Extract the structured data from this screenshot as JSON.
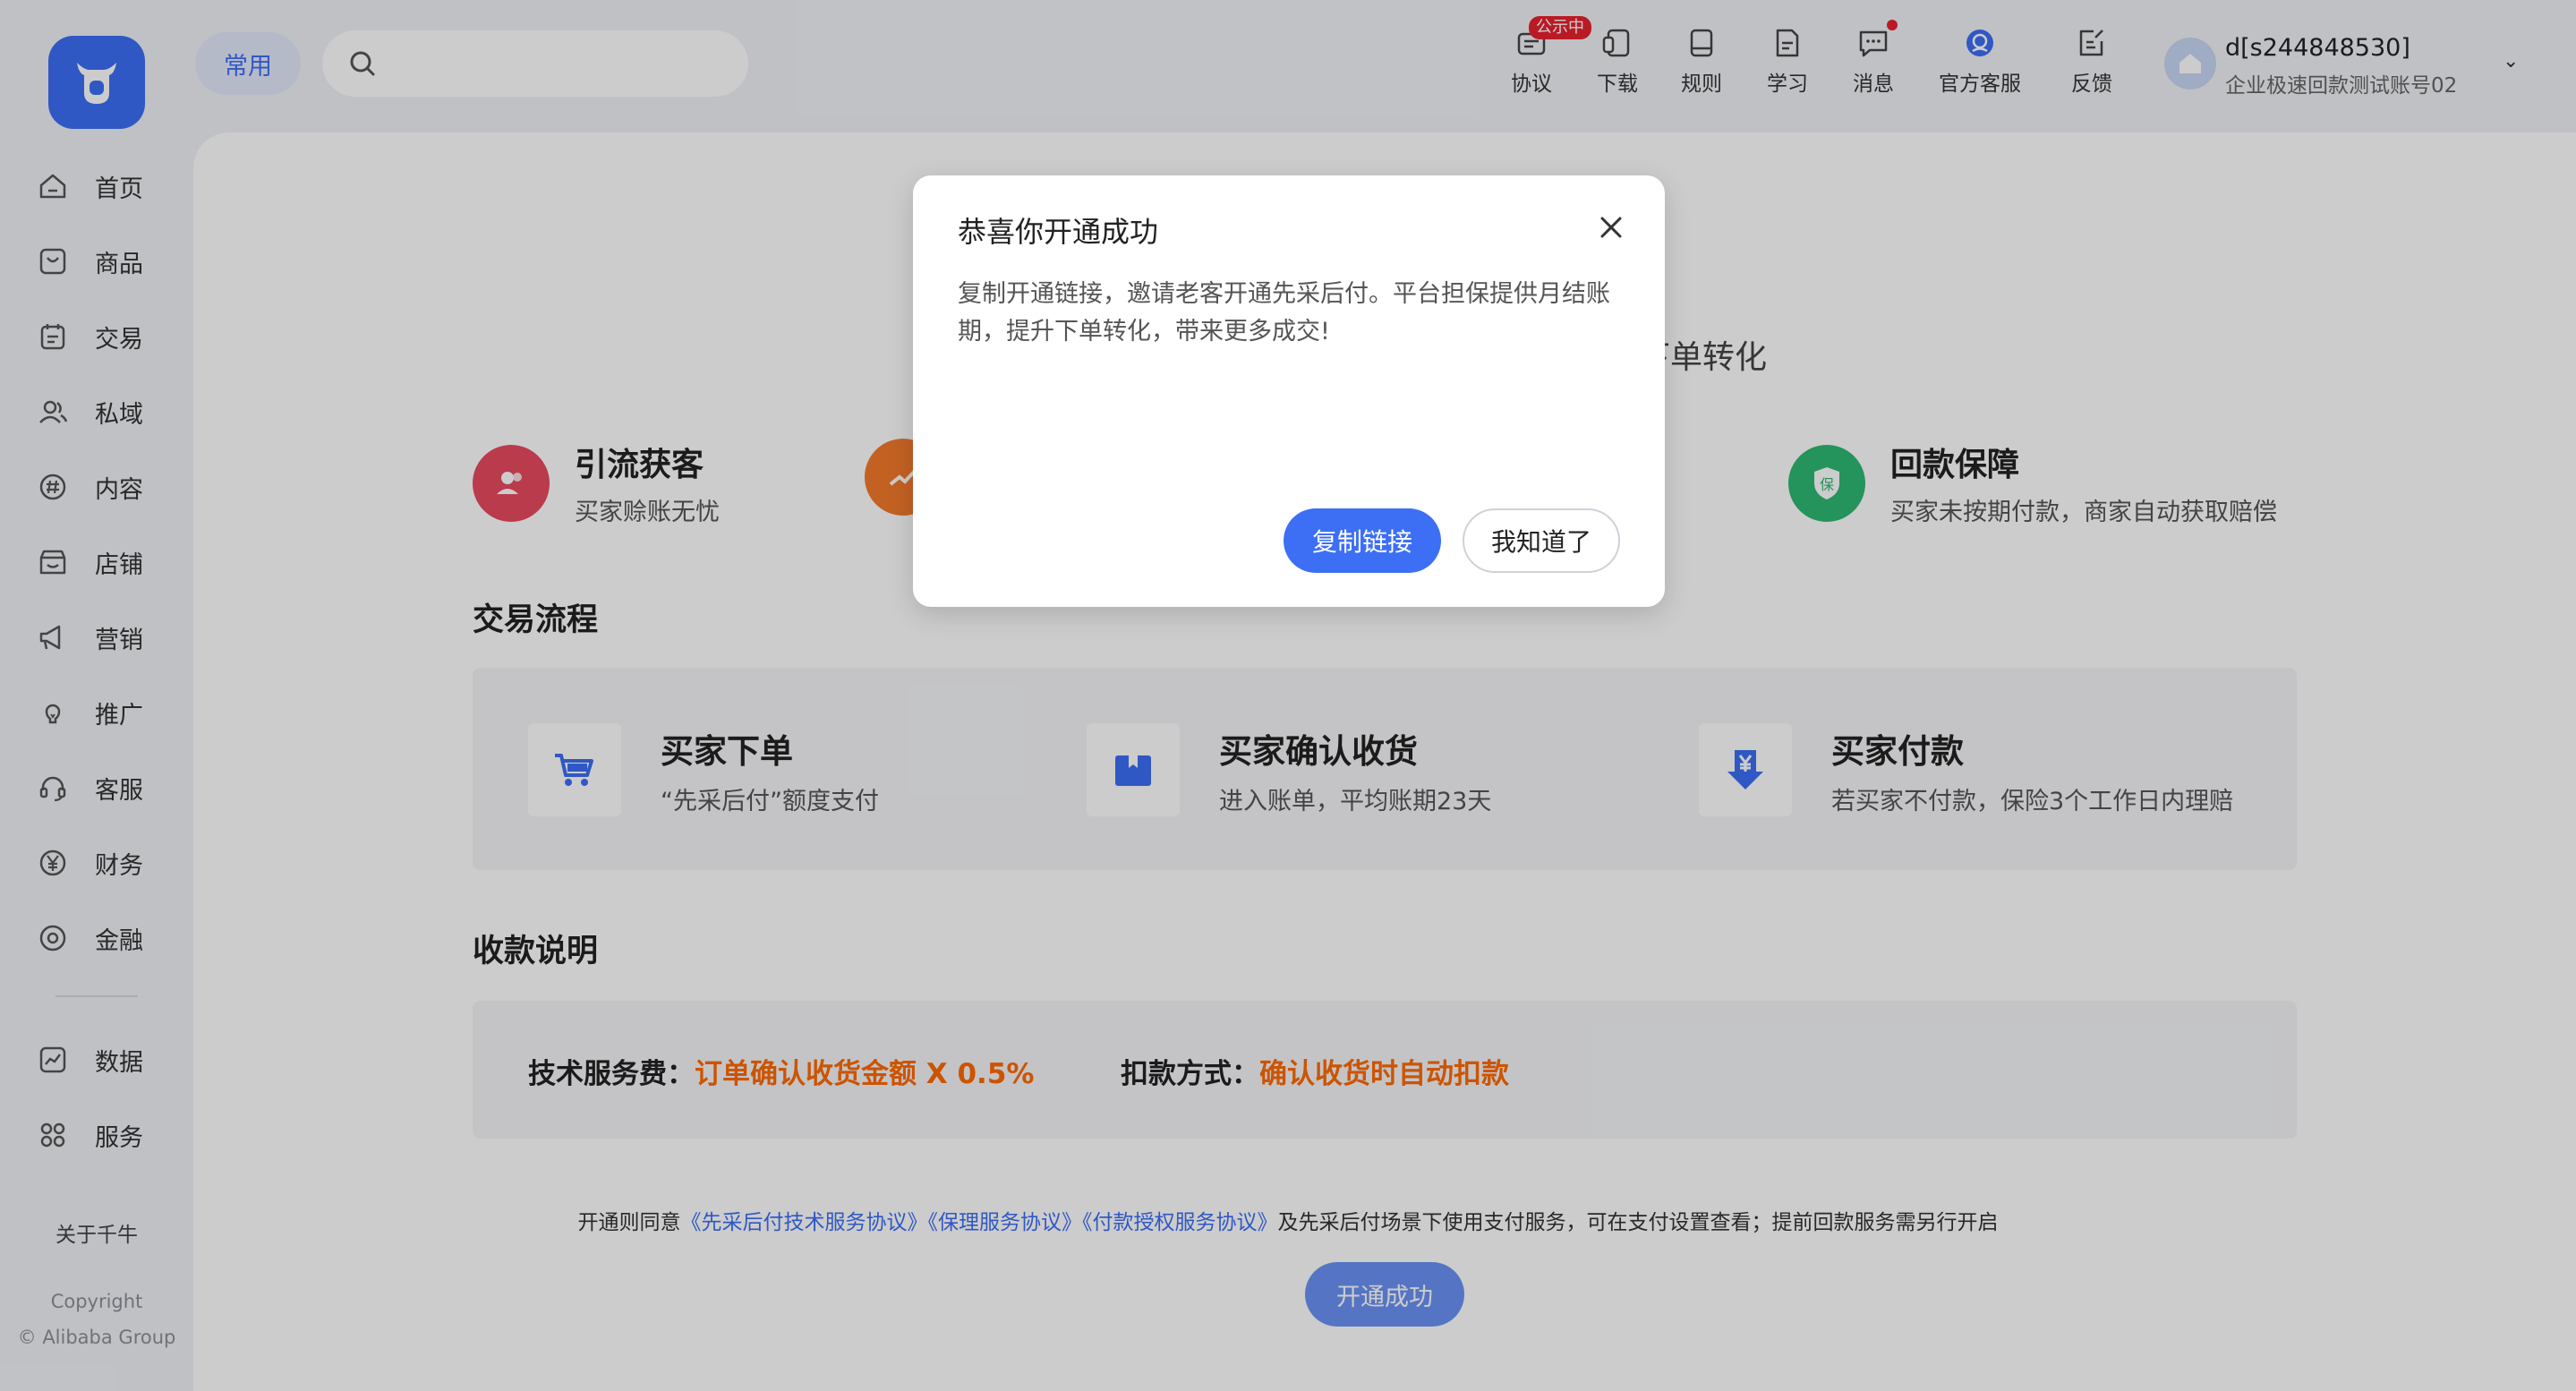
{
  "sidebar": {
    "items": [
      {
        "label": "首页",
        "icon": "home-icon"
      },
      {
        "label": "商品",
        "icon": "goods-icon"
      },
      {
        "label": "交易",
        "icon": "trade-icon"
      },
      {
        "label": "私域",
        "icon": "private-domain-icon"
      },
      {
        "label": "内容",
        "icon": "content-icon"
      },
      {
        "label": "店铺",
        "icon": "store-icon"
      },
      {
        "label": "营销",
        "icon": "megaphone-icon"
      },
      {
        "label": "推广",
        "icon": "lightbulb-icon"
      },
      {
        "label": "客服",
        "icon": "headset-icon"
      },
      {
        "label": "财务",
        "icon": "yen-icon"
      },
      {
        "label": "金融",
        "icon": "finance-icon"
      }
    ],
    "bottom_items": [
      {
        "label": "数据",
        "icon": "chart-icon"
      },
      {
        "label": "服务",
        "icon": "grid-icon"
      }
    ],
    "about": "关于千牛",
    "copyright_line1": "Copyright",
    "copyright_line2": "© Alibaba Group"
  },
  "header": {
    "common_label": "常用",
    "search_placeholder": "",
    "tools": [
      {
        "label": "协议",
        "icon": "agreement-icon"
      },
      {
        "label": "下载",
        "icon": "download-icon"
      },
      {
        "label": "规则",
        "icon": "rules-icon"
      },
      {
        "label": "学习",
        "icon": "study-icon"
      },
      {
        "label": "消息",
        "icon": "message-icon"
      },
      {
        "label": "官方客服",
        "icon": "official-service-icon"
      },
      {
        "label": "反馈",
        "icon": "feedback-icon"
      }
    ],
    "agreement_badge": "公示中",
    "account_name": "d[s244848530]",
    "account_sub": "企业极速回款测试账号02"
  },
  "main": {
    "hero_partial": "下单转化",
    "benefits": [
      {
        "title": "引流获客",
        "desc": "买家赊账无忧",
        "color": "#e84a5f"
      },
      {
        "title": "回款保障",
        "desc": "买家未按期付款，商家自动获取赔偿",
        "color": "#2eb873",
        "badge": "保"
      }
    ],
    "flow_title": "交易流程",
    "steps": [
      {
        "title": "买家下单",
        "desc": "“先采后付”额度支付"
      },
      {
        "title": "买家确认收货",
        "desc": "进入账单，平均账期23天"
      },
      {
        "title": "买家付款",
        "desc": "若买家不付款，保险3个工作日内理赔"
      }
    ],
    "fee_title": "收款说明",
    "fee_label": "技术服务费：",
    "fee_value": "订单确认收货金额 X 0.5%",
    "deduct_label": "扣款方式：",
    "deduct_value": "确认收货时自动扣款",
    "agreement_prefix": "开通则同意",
    "agreement_link1": "《先采后付技术服务协议》",
    "agreement_link2": "《保理服务协议》",
    "agreement_link3": "《付款授权服务协议》",
    "agreement_suffix": "及先采后付场景下使用支付服务，可在支付设置查看；提前回款服务需另行开启",
    "open_button": "开通成功"
  },
  "modal": {
    "title": "恭喜你开通成功",
    "body": "复制开通链接，邀请老客开通先采后付。平台担保提供月结账期，提升下单转化，带来更多成交!",
    "copy_button": "复制链接",
    "ok_button": "我知道了"
  },
  "colors": {
    "primary": "#3d6ff5",
    "accent_orange": "#ff6a00",
    "badge_red": "#e8222e"
  }
}
